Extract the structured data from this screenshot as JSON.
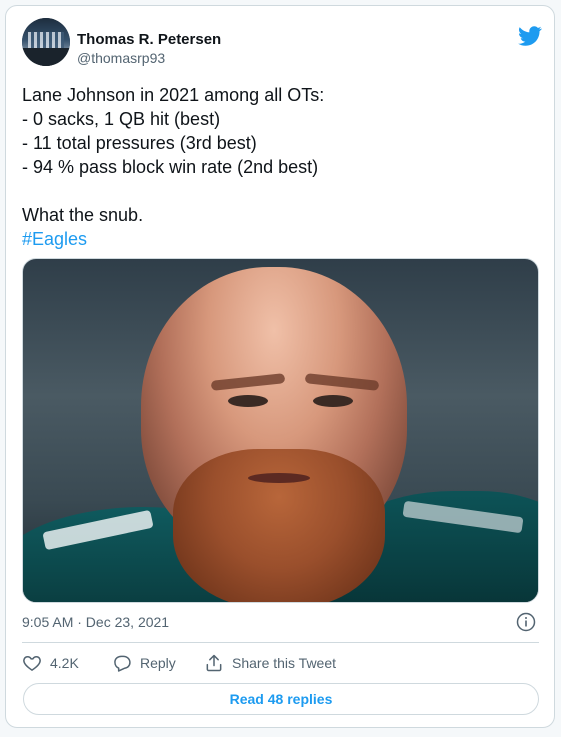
{
  "author": {
    "name": "Thomas R. Petersen",
    "handle": "@thomasrp93"
  },
  "tweet": {
    "lines": [
      "Lane Johnson in 2021 among all OTs:",
      "- 0 sacks, 1 QB hit (best)",
      "- 11 total pressures (3rd best)",
      "- 94 % pass block win rate (2nd best)"
    ],
    "closing": "What the snub.",
    "hashtag": "#Eagles"
  },
  "meta": {
    "timestamp": "9:05 AM · Dec 23, 2021"
  },
  "actions": {
    "likes": "4.2K",
    "reply_label": "Reply",
    "share_label": "Share this Tweet"
  },
  "read_replies_label": "Read 48 replies",
  "colors": {
    "accent": "#1d9bf0",
    "muted": "#536471",
    "border": "#cfd9de"
  },
  "icons": [
    "twitter-bird-icon",
    "info-icon",
    "heart-icon",
    "reply-icon",
    "share-icon"
  ]
}
